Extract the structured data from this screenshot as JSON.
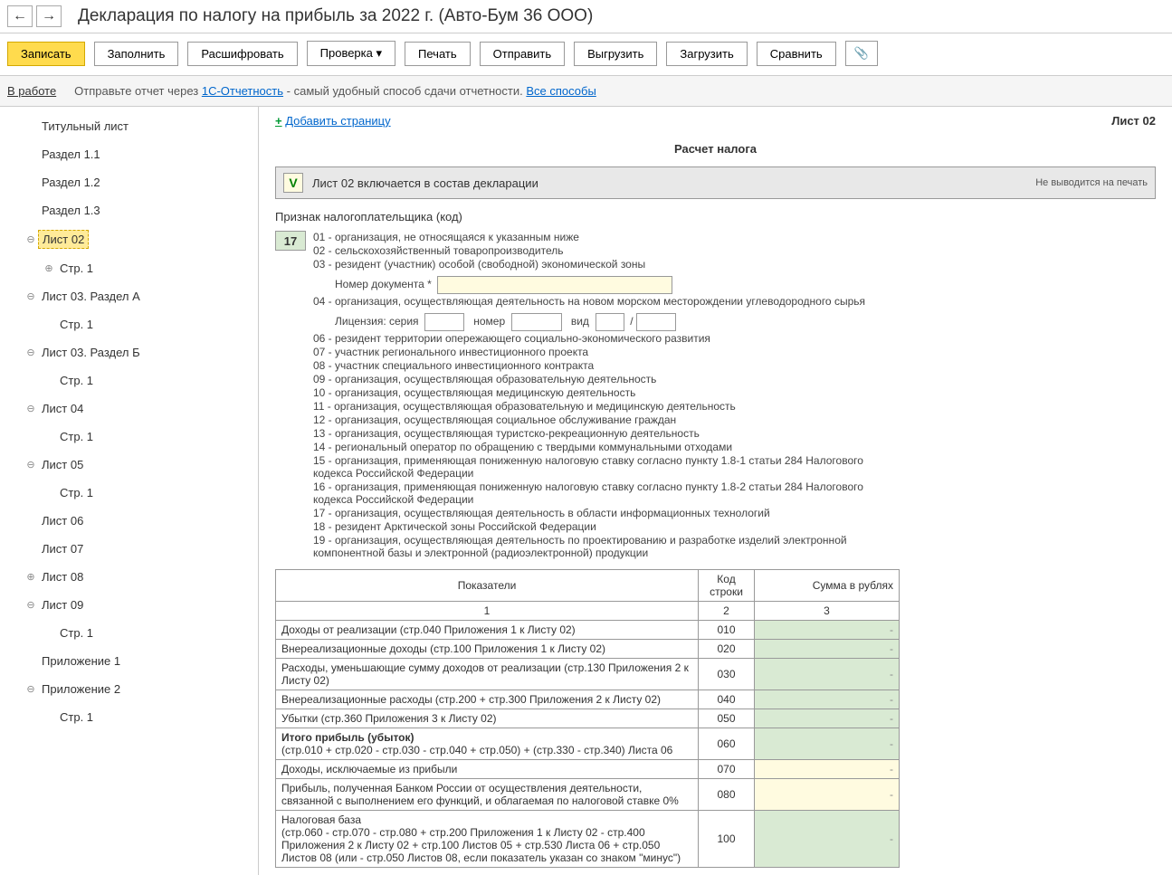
{
  "header": {
    "title": "Декларация по налогу на прибыль за 2022 г. (Авто-Бум 36 ООО)"
  },
  "toolbar": {
    "save": "Записать",
    "fill": "Заполнить",
    "decrypt": "Расшифровать",
    "check": "Проверка",
    "print": "Печать",
    "send": "Отправить",
    "export": "Выгрузить",
    "import": "Загрузить",
    "compare": "Сравнить"
  },
  "infobar": {
    "status": "В работе",
    "text_prefix": "Отправьте отчет через ",
    "link1": "1С-Отчетность",
    "text_mid": " - самый удобный способ сдачи отчетности. ",
    "link2": "Все способы"
  },
  "sidebar": {
    "items": [
      {
        "label": "Титульный лист",
        "lvl": 1
      },
      {
        "label": "Раздел 1.1",
        "lvl": 1
      },
      {
        "label": "Раздел 1.2",
        "lvl": 1
      },
      {
        "label": "Раздел 1.3",
        "lvl": 1
      },
      {
        "label": "Лист 02",
        "lvl": 1,
        "toggle": "⊖",
        "active": true
      },
      {
        "label": "Стр. 1",
        "lvl": 2,
        "toggle": "⊕"
      },
      {
        "label": "Лист 03. Раздел А",
        "lvl": 1,
        "toggle": "⊖"
      },
      {
        "label": "Стр. 1",
        "lvl": 2
      },
      {
        "label": "Лист 03. Раздел Б",
        "lvl": 1,
        "toggle": "⊖"
      },
      {
        "label": "Стр. 1",
        "lvl": 2
      },
      {
        "label": "Лист 04",
        "lvl": 1,
        "toggle": "⊖"
      },
      {
        "label": "Стр. 1",
        "lvl": 2
      },
      {
        "label": "Лист 05",
        "lvl": 1,
        "toggle": "⊖"
      },
      {
        "label": "Стр. 1",
        "lvl": 2
      },
      {
        "label": "Лист 06",
        "lvl": 1
      },
      {
        "label": "Лист 07",
        "lvl": 1
      },
      {
        "label": "Лист 08",
        "lvl": 1,
        "toggle": "⊕"
      },
      {
        "label": "Лист 09",
        "lvl": 1,
        "toggle": "⊖"
      },
      {
        "label": "Стр. 1",
        "lvl": 2
      },
      {
        "label": "Приложение 1",
        "lvl": 1
      },
      {
        "label": "Приложение 2",
        "lvl": 1,
        "toggle": "⊖"
      },
      {
        "label": "Стр. 1",
        "lvl": 2
      }
    ]
  },
  "content": {
    "add_page": "Добавить страницу",
    "sheet": "Лист 02",
    "calc_title": "Расчет налога",
    "include_check": "V",
    "include_text": "Лист 02 включается в состав декларации",
    "no_print": "Не выводится на печать",
    "taxpayer_label": "Признак налогоплательщика (код)",
    "code_value": "17",
    "codes": [
      "01 - организация, не относящаяся к указанным ниже",
      "02 - сельскохозяйственный товаропроизводитель",
      "03 - резидент (участник) особой (свободной) экономической зоны"
    ],
    "doc_number_label": "Номер документа *",
    "code04": "04 - организация, осуществляющая деятельность на новом морском месторождении углеводородного сырья",
    "license_label": "Лицензия:  серия",
    "license_number": "номер",
    "license_type": "вид",
    "codes2": [
      "06 - резидент территории опережающего социально-экономического развития",
      "07 - участник регионального инвестиционного проекта",
      "08 - участник специального инвестиционного контракта",
      "09 - организация, осуществляющая образовательную деятельность",
      "10 - организация, осуществляющая медицинскую деятельность",
      "11 - организация, осуществляющая образовательную и медицинскую деятельность",
      "12 - организация, осуществляющая социальное обслуживание граждан",
      "13 - организация, осуществляющая туристско-рекреационную деятельность",
      "14 - региональный оператор по обращению с твердыми коммунальными отходами",
      "15 - организация, применяющая пониженную налоговую ставку согласно пункту 1.8-1 статьи 284 Налогового кодекса Российской Федерации",
      "16 - организация, применяющая пониженную налоговую ставку согласно пункту 1.8-2 статьи 284 Налогового кодекса Российской Федерации",
      "17 - организация, осуществляющая деятельность в области информационных технологий",
      "18 - резидент Арктической зоны Российской Федерации",
      "19 - организация, осуществляющая деятельность по проектированию и разработке изделий электронной компонентной базы и электронной (радиоэлектронной) продукции"
    ],
    "table_headers": {
      "col1": "Показатели",
      "col2": "Код строки",
      "col3": "Сумма в рублях",
      "n1": "1",
      "n2": "2",
      "n3": "3"
    },
    "rows": [
      {
        "name": "Доходы от реализации (стр.040 Приложения 1 к Листу 02)",
        "code": "010",
        "cls": "row-green"
      },
      {
        "name": "Внереализационные доходы (стр.100 Приложения 1 к Листу 02)",
        "code": "020",
        "cls": "row-green"
      },
      {
        "name": "Расходы, уменьшающие сумму доходов от реализации (стр.130 Приложения 2 к Листу 02)",
        "code": "030",
        "cls": "row-green"
      },
      {
        "name": "Внереализационные расходы (стр.200 + стр.300 Приложения 2 к Листу 02)",
        "code": "040",
        "cls": "row-green"
      },
      {
        "name": "Убытки (стр.360 Приложения 3 к Листу 02)",
        "code": "050",
        "cls": "row-green"
      },
      {
        "name": "<b>Итого прибыль (убыток)</b><br>(стр.010 + стр.020 - стр.030 - стр.040 + стр.050) + (стр.330 - стр.340) Листа 06",
        "code": "060",
        "cls": "row-green",
        "html": true
      },
      {
        "name": "Доходы, исключаемые из прибыли",
        "code": "070",
        "cls": "row-yellow"
      },
      {
        "name": "Прибыль, полученная Банком России от осуществления деятельности, связанной с выполнением его функций, и облагаемая по налоговой ставке 0%",
        "code": "080",
        "cls": "row-yellow"
      },
      {
        "name": "Налоговая база<br>(стр.060 - стр.070 - стр.080 + стр.200 Приложения 1 к Листу 02 - стр.400 Приложения 2 к Листу 02 + стр.100 Листов 05 + стр.530 Листа 06 + стр.050 Листов 08 (или - стр.050 Листов 08, если показатель указан со знаком \"минус\")",
        "code": "100",
        "cls": "row-green",
        "html": true
      }
    ]
  }
}
